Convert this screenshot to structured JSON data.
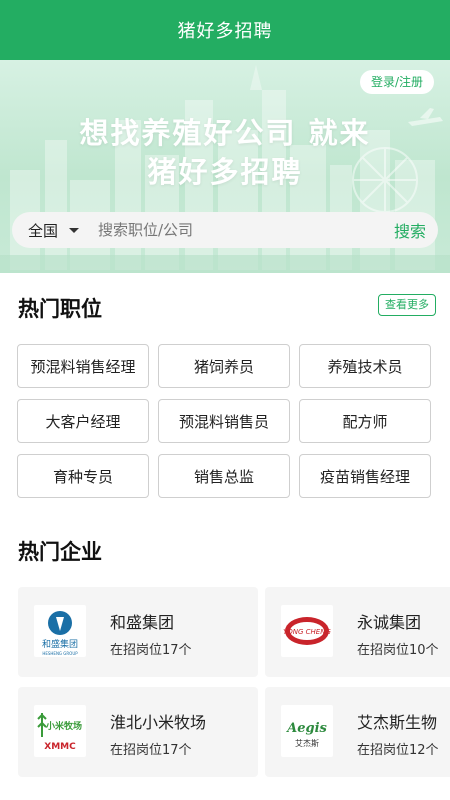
{
  "header": {
    "title": "猪好多招聘"
  },
  "hero": {
    "login_label": "登录/注册",
    "slogan_line1": "想找养殖好公司 就来",
    "slogan_line2": "猪好多招聘"
  },
  "search": {
    "region": "全国",
    "placeholder": "搜索职位/公司",
    "button_label": "搜索"
  },
  "hot_jobs": {
    "title": "热门职位",
    "more_label": "查看更多",
    "items": [
      "预混料销售经理",
      "猪饲养员",
      "养殖技术员",
      "大客户经理",
      "预混料销售员",
      "配方师",
      "育种专员",
      "销售总监",
      "疫苗销售经理"
    ]
  },
  "hot_companies": {
    "title": "热门企业",
    "items": [
      {
        "name": "和盛集团",
        "jobs": "在招岗位17个",
        "logo_text": "和盛集团",
        "logo_subtext": "HESHENG GROUP"
      },
      {
        "name": "永诚集团",
        "jobs": "在招岗位10个",
        "logo_text": "YONG CHENG"
      },
      {
        "name": "淮北小米牧场",
        "jobs": "在招岗位17个",
        "logo_text": "小米牧场",
        "logo_subtext": "XMMC"
      },
      {
        "name": "艾杰斯生物",
        "jobs": "在招岗位12个",
        "logo_text": "Aegis",
        "logo_subtext": "艾杰斯"
      }
    ]
  },
  "colors": {
    "brand": "#23ad62",
    "hero_bg": "#c8ead7"
  }
}
